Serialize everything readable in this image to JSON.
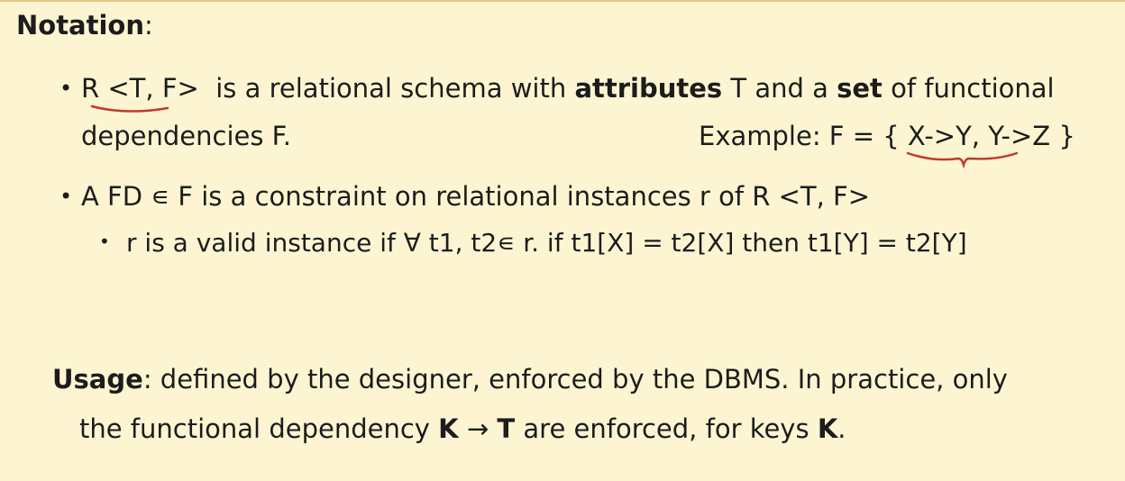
{
  "notation": {
    "heading": "Notation",
    "colon": ":"
  },
  "bullet1": {
    "bullet": "•",
    "schema": "R <T, F>",
    "text_a": "is a relational schema with ",
    "attributes": "attributes",
    "text_b": " T and a ",
    "set": "set",
    "text_c": " of functional",
    "line2": "dependencies  F.",
    "example_label": "Example: F = { ",
    "example_fds": "X->Y, Y->Z",
    "example_close": " }"
  },
  "bullet2": {
    "bullet": "•",
    "text": "A FD ∊ F is a constraint on relational instances r of R <T, F>"
  },
  "subbullet": {
    "bullet": "•",
    "text": "r is a valid instance if ∀ t1, t2∊ r.  if t1[X] = t2[X]  then  t1[Y] = t2[Y]"
  },
  "usage": {
    "heading": "Usage",
    "colon": ":",
    "text_a": " defined by the designer, enforced by the DBMS. In practice, only",
    "line2_a": "the functional dependency ",
    "k1": "K",
    "arrow": " → ",
    "t": "T",
    "line2_b": " are enforced, for keys ",
    "k2": "K",
    "period": "."
  },
  "colors": {
    "background": "#fdf5d2",
    "annotation": "#c0392b"
  }
}
